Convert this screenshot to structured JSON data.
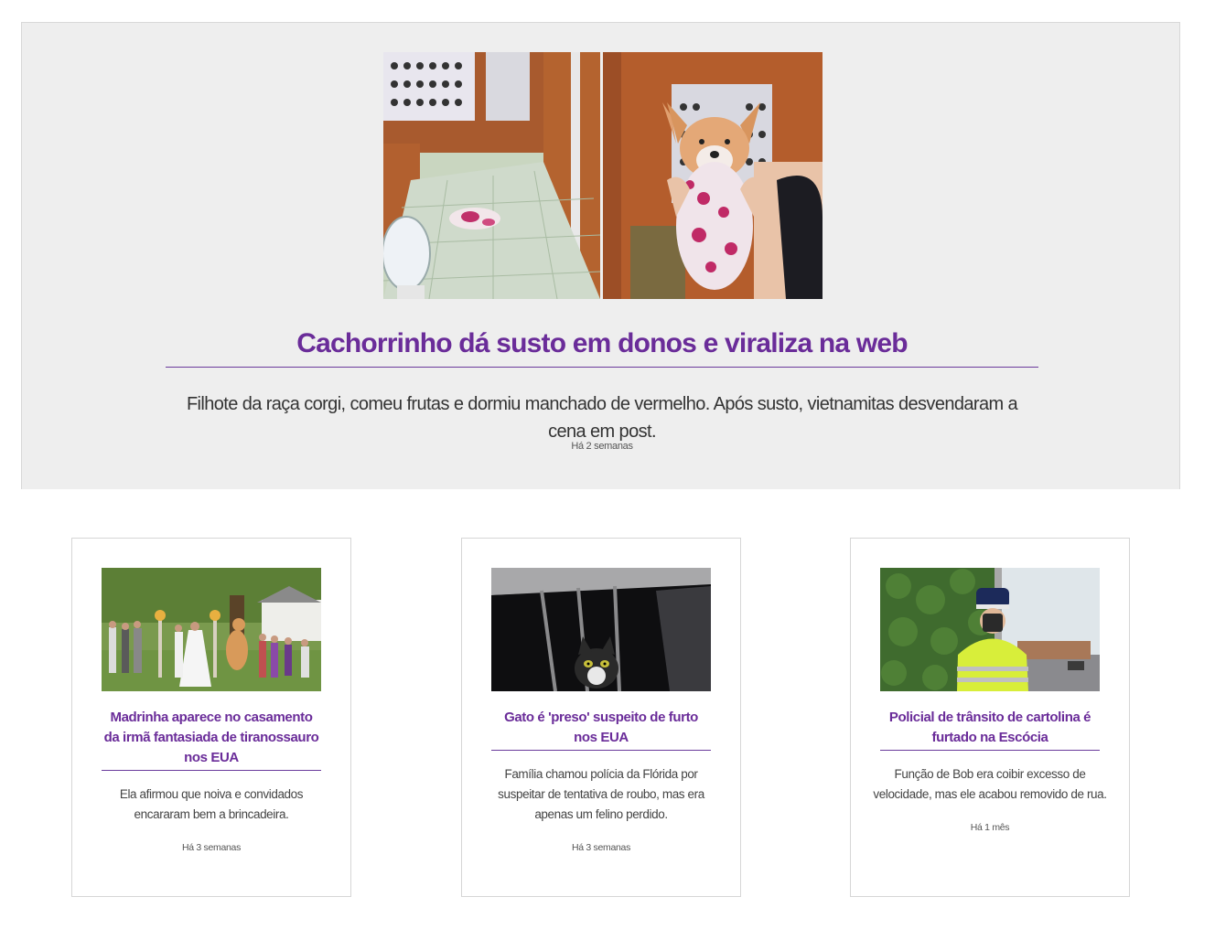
{
  "featured": {
    "title": "Cachorrinho dá susto em donos e viraliza na web",
    "description": "Filhote da raça corgi, comeu frutas e dormiu manchado de vermelho. Após susto, vietnamitas desvendaram a cena em post.",
    "time": "Há 2 semanas"
  },
  "cards": [
    {
      "title": "Madrinha aparece no casamento da irmã fantasiada de tiranossauro nos EUA",
      "description": "Ela afirmou que noiva e convidados encararam bem a brincadeira.",
      "time": "Há 3 semanas"
    },
    {
      "title": "Gato é 'preso' suspeito de furto nos EUA",
      "description": "Família chamou polícia da Flórida por suspeitar de tentativa de roubo, mas era apenas um felino perdido.",
      "time": "Há 3 semanas"
    },
    {
      "title": "Policial de trânsito de cartolina é furtado na Escócia",
      "description": "Função de Bob era coibir excesso de velocidade, mas ele acabou removido de rua.",
      "time": "Há 1 mês"
    }
  ],
  "colors": {
    "accent": "#6a2c99",
    "featured_bg": "#eeeeee",
    "card_border": "#d6d6d6"
  }
}
